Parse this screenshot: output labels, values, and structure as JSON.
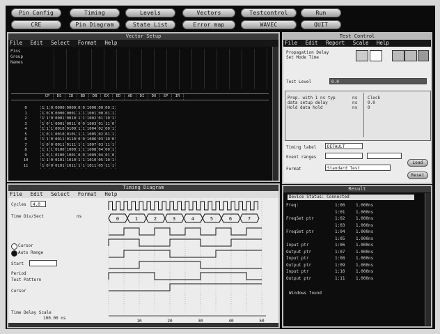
{
  "toolbar": {
    "row1": [
      "Pin Config",
      "Timing",
      "Levels",
      "Vectors",
      "Testcontrol",
      "Run"
    ],
    "row2": [
      "CRE",
      "Pin Diagram",
      "State List",
      "Error map",
      "WAVEC",
      "QUIT"
    ]
  },
  "vector_window": {
    "title": "Vector Setup",
    "menu": [
      "File",
      "Edit",
      "Select",
      "Format",
      "Help"
    ],
    "pin_labels": [
      "Pins",
      "Group",
      "Names"
    ],
    "header_cols": [
      "CP",
      "DS",
      "ID",
      "BD",
      "DB",
      "EX",
      "ED",
      "AD",
      "DI",
      "DO",
      "SP",
      "IR"
    ],
    "rows": [
      [
        "0",
        "1",
        "1",
        "0",
        "0000",
        "0000",
        "0",
        "0",
        "1000",
        "00",
        "00",
        "1"
      ],
      [
        "1",
        "1",
        "0",
        "0",
        "0000",
        "0001",
        "1",
        "1",
        "1001",
        "00",
        "01",
        "1"
      ],
      [
        "2",
        "1",
        "1",
        "0",
        "0001",
        "0010",
        "1",
        "1",
        "1002",
        "01",
        "10",
        "1"
      ],
      [
        "3",
        "1",
        "0",
        "1",
        "0001",
        "0011",
        "0",
        "0",
        "1003",
        "01",
        "11",
        "0"
      ],
      [
        "4",
        "1",
        "1",
        "1",
        "0010",
        "0100",
        "1",
        "1",
        "1004",
        "02",
        "00",
        "1"
      ],
      [
        "5",
        "1",
        "0",
        "1",
        "0010",
        "0101",
        "1",
        "1",
        "1005",
        "02",
        "01",
        "1"
      ],
      [
        "6",
        "1",
        "1",
        "0",
        "0011",
        "0110",
        "0",
        "0",
        "1006",
        "03",
        "10",
        "0"
      ],
      [
        "7",
        "1",
        "0",
        "0",
        "0011",
        "0111",
        "1",
        "1",
        "1007",
        "03",
        "11",
        "1"
      ],
      [
        "8",
        "1",
        "1",
        "1",
        "0100",
        "1000",
        "1",
        "1",
        "1008",
        "04",
        "00",
        "1"
      ],
      [
        "9",
        "1",
        "0",
        "1",
        "0100",
        "1001",
        "0",
        "0",
        "1009",
        "04",
        "01",
        "0"
      ],
      [
        "10",
        "1",
        "1",
        "0",
        "0101",
        "1010",
        "1",
        "1",
        "1010",
        "05",
        "10",
        "1"
      ],
      [
        "11",
        "1",
        "0",
        "0",
        "0101",
        "1011",
        "1",
        "1",
        "1011",
        "05",
        "11",
        "1"
      ]
    ]
  },
  "test_window": {
    "title": "Test Control",
    "menu": [
      "File",
      "Edit",
      "Report",
      "Scale",
      "Help"
    ],
    "prop_delay_label": "Propagation Delay",
    "set_mode_label": "Set Mode Time",
    "test_label": "Test Level",
    "test_value": "0.0",
    "param_lines": [
      "Prop. with 1 ns  typ",
      "data setup delay",
      "Hold data hold"
    ],
    "param_values": [
      "ns",
      "ns",
      "ns"
    ],
    "right_lines": [
      "Clock",
      "0.0"
    ],
    "right_value": "0",
    "timing_label": "Timing label",
    "timing_value": "DEFAULT",
    "event_label": "Event ranges",
    "format_label": "Format",
    "format_value": "Standard Test",
    "btn_load": "Load",
    "btn_reset": "Reset"
  },
  "wave_window": {
    "title": "Timing Diagram",
    "menu": [
      "File",
      "Edit",
      "Select",
      "Format",
      "Help"
    ],
    "left_labels": [
      "Cycles",
      "Time Div/Sect",
      "Cursor",
      "Auto Range",
      "Start",
      "Period",
      "Test Pattern",
      "Cursor"
    ],
    "field_vals": [
      "4.0",
      "ns"
    ],
    "bus_values": [
      "0",
      "1",
      "2",
      "3",
      "4",
      "5",
      "6",
      "7"
    ],
    "bottom_label": "Time Delay Scale",
    "bottom_value": "100.00 ns",
    "axis_ticks": [
      "10",
      "20",
      "30",
      "40",
      "50"
    ]
  },
  "result_window": {
    "title": "Result",
    "status": "Device Status: Connected",
    "rows": [
      [
        "Freq: ",
        "1:00",
        "1.000ns"
      ],
      [
        "",
        "1:01",
        "1.000ns"
      ],
      [
        "FreqSet  ptr",
        "1:02",
        "1.000ns"
      ],
      [
        "",
        "1:03",
        "1.000ns"
      ],
      [
        "FreqSet  ptr",
        "1:04",
        "1.000ns"
      ],
      [
        "",
        "1:05",
        "1.000ns"
      ],
      [
        "Input  ptr",
        "1:06",
        "1.000ns"
      ],
      [
        "Output  ptr",
        "1:07",
        "1.000ns"
      ],
      [
        "Input  ptr",
        "1:08",
        "1.000ns"
      ],
      [
        "Output  ptr",
        "1:09",
        "1.000ns"
      ],
      [
        "Input  ptr",
        "1:10",
        "1.000ns"
      ],
      [
        "Output  ptr",
        "1:11",
        "1.000ns"
      ]
    ],
    "footer": "Windows found"
  }
}
